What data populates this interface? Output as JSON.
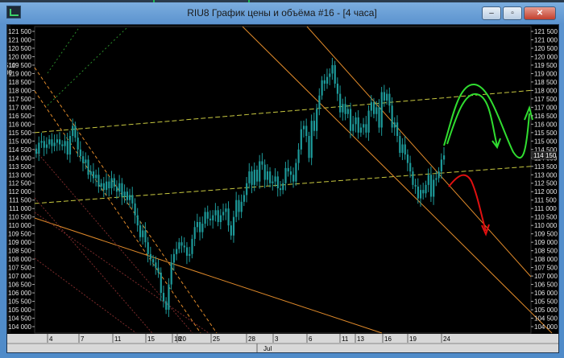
{
  "window": {
    "title": "RIU8 График цены и объёма #16 - [4 часа]",
    "buttons": {
      "minimize": "–",
      "restore": "▫",
      "close": "✕"
    }
  },
  "left_edge_labels": [
    "510",
    "00"
  ],
  "chart_data": {
    "type": "candlestick",
    "price_axis": {
      "min": 104000,
      "max": 121500,
      "step": 500,
      "ticks": [
        "121 500",
        "121 000",
        "120 500",
        "120 000",
        "119 500",
        "119 000",
        "118 500",
        "118 000",
        "117 500",
        "117 000",
        "116 500",
        "116 000",
        "115 500",
        "115 000",
        "114 500",
        "114 000",
        "113 500",
        "113 000",
        "112 500",
        "112 000",
        "111 500",
        "111 000",
        "110 500",
        "110 000",
        "109 500",
        "109 000",
        "108 500",
        "108 000",
        "107 500",
        "107 000",
        "106 500",
        "106 000",
        "105 500",
        "105 000",
        "104 500",
        "104 000"
      ]
    },
    "last_price_label": "114 150",
    "date_axis": {
      "labels": [
        "4",
        "7",
        "11",
        "15",
        "18",
        "20",
        "25",
        "28",
        "3",
        "6",
        "11",
        "13",
        "16",
        "19",
        "24"
      ],
      "month_label": "Jul"
    },
    "colors": {
      "candles": "#1d9a9a",
      "channel_up": "#c8c840",
      "channel_down": "#e08a2a",
      "arrow_green": "#30dd30",
      "arrow_red": "#e01010",
      "grid_dots": "#7a2a2a",
      "green_dashed": "#2a8a2a"
    },
    "closes": [
      114250,
      114900,
      115000,
      114600,
      114800,
      115100,
      114700,
      114900,
      115100,
      114800,
      114700,
      115000,
      114200,
      115300,
      115900,
      115200,
      114500,
      114100,
      113700,
      113900,
      113000,
      113200,
      112800,
      113000,
      112300,
      112500,
      112100,
      112600,
      112200,
      112800,
      112300,
      112000,
      112500,
      111700,
      112000,
      111500,
      111800,
      111300,
      110600,
      110000,
      109300,
      109700,
      109000,
      108300,
      108000,
      107800,
      107500,
      107200,
      106000,
      105500,
      105000,
      106500,
      107800,
      108300,
      108600,
      109000,
      108800,
      108700,
      108200,
      108300,
      109200,
      109900,
      110200,
      109600,
      110100,
      110800,
      110400,
      110300,
      110600,
      110900,
      110200,
      110600,
      110800,
      111000,
      110000,
      109400,
      110500,
      111500,
      110800,
      111400,
      111800,
      112500,
      113200,
      112400,
      113300,
      112600,
      113800,
      113600,
      112700,
      113200,
      112500,
      112600,
      112900,
      112200,
      112100,
      112500,
      113400,
      113200,
      113000,
      112600,
      113700,
      114500,
      115700,
      115900,
      115300,
      114000,
      116200,
      115600,
      116900,
      117700,
      118600,
      118400,
      118800,
      119000,
      119500,
      118400,
      117800,
      116700,
      117200,
      116600,
      116900,
      115600,
      116000,
      116400,
      115500,
      115800,
      116000,
      115500,
      116800,
      117300,
      116600,
      117000,
      115800,
      117900,
      117400,
      117800,
      117100,
      115800,
      116100,
      115300,
      114300,
      114800,
      114200,
      113700,
      113200,
      112400,
      112300,
      111600,
      112100,
      111900,
      112400,
      113000,
      111700,
      112700,
      112800,
      113200,
      113900,
      114150
    ]
  }
}
